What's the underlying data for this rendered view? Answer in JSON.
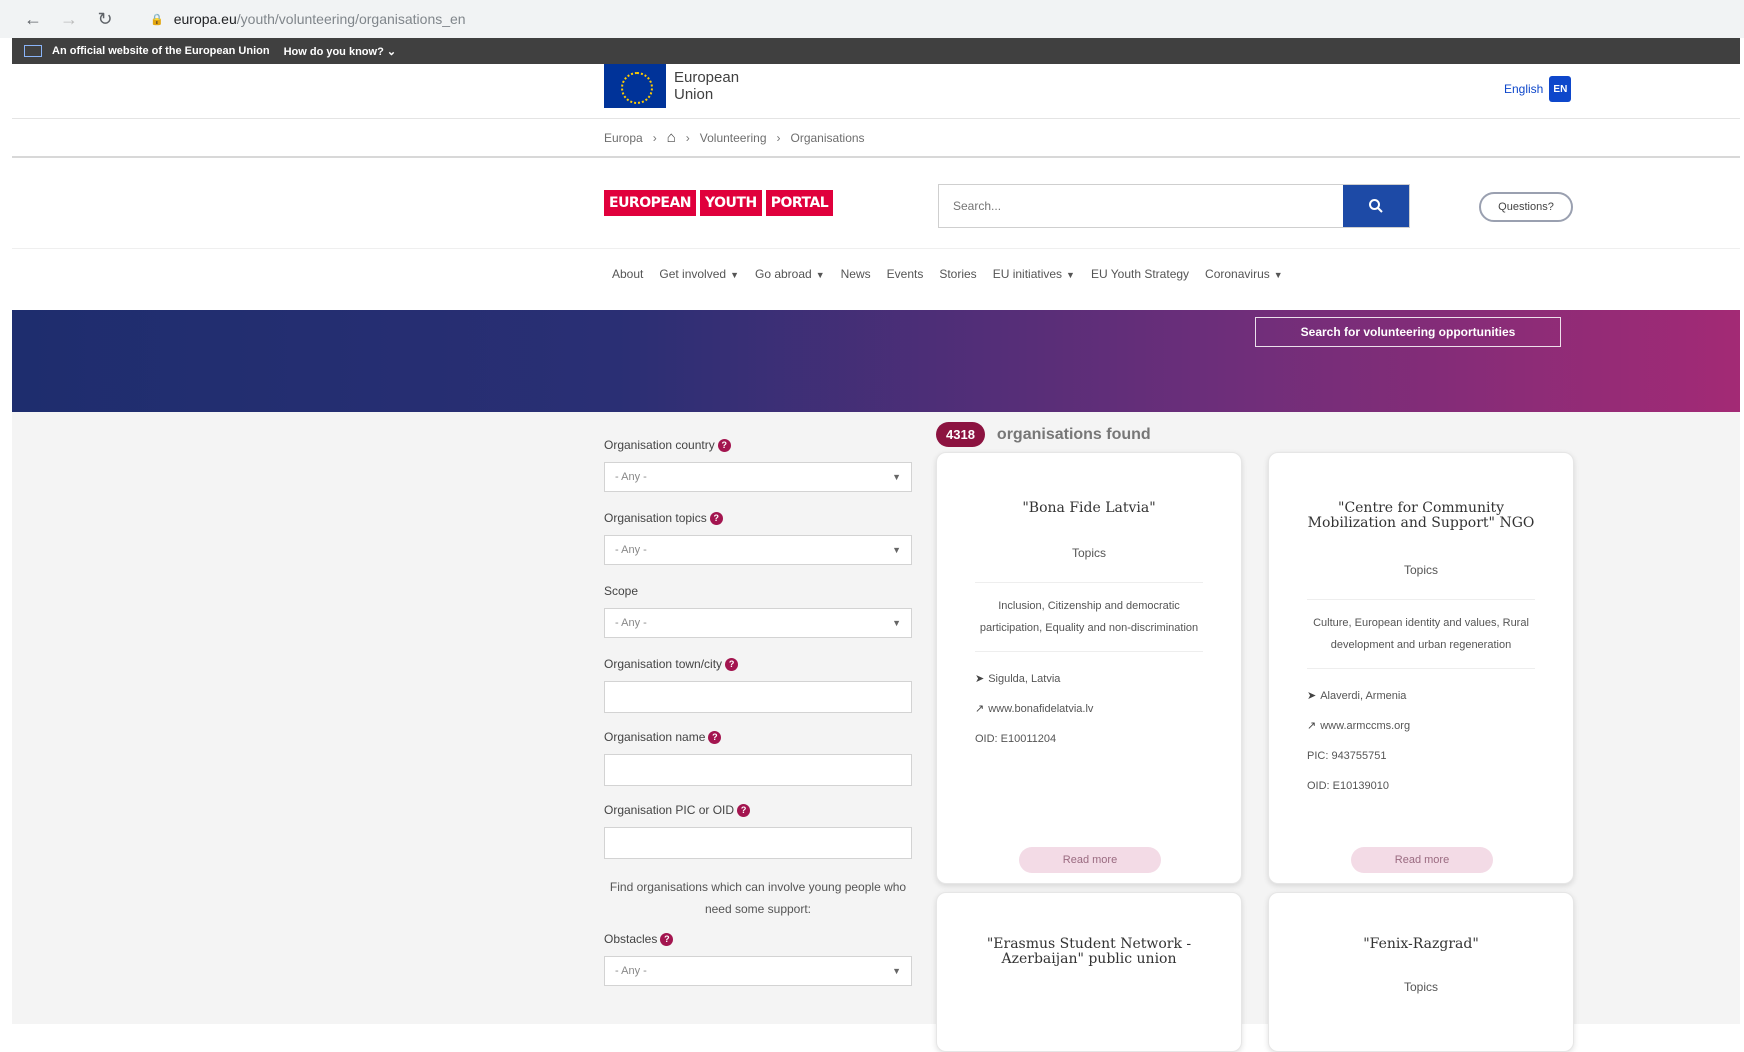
{
  "browser": {
    "url_domain": "europa.eu",
    "url_path": "/youth/volunteering/organisations_en"
  },
  "official_banner": {
    "text": "An official website of the European Union",
    "how": "How do you know?"
  },
  "eu_header": {
    "logo_line1": "European",
    "logo_line2": "Union",
    "language": "English",
    "language_code": "EN"
  },
  "breadcrumb": {
    "items": [
      "Europa",
      "Volunteering",
      "Organisations"
    ]
  },
  "portal": {
    "logo_words": [
      "EUROPEAN",
      "YOUTH",
      "PORTAL"
    ],
    "search_placeholder": "Search...",
    "questions_label": "Questions?"
  },
  "nav": {
    "items": [
      {
        "label": "About",
        "dropdown": false
      },
      {
        "label": "Get involved",
        "dropdown": true
      },
      {
        "label": "Go abroad",
        "dropdown": true
      },
      {
        "label": "News",
        "dropdown": false
      },
      {
        "label": "Events",
        "dropdown": false
      },
      {
        "label": "Stories",
        "dropdown": false
      },
      {
        "label": "EU initiatives",
        "dropdown": true
      },
      {
        "label": "EU Youth Strategy",
        "dropdown": false
      },
      {
        "label": "Coronavirus",
        "dropdown": true
      }
    ]
  },
  "hero": {
    "button_label": "Search for volunteering opportunities"
  },
  "filters": {
    "country_label": "Organisation country",
    "topics_label": "Organisation topics",
    "scope_label": "Scope",
    "town_label": "Organisation town/city",
    "name_label": "Organisation name",
    "pic_label": "Organisation PIC or OID",
    "any_option": "- Any -",
    "note": "Find organisations which can involve young people who need some support:",
    "obstacles_label": "Obstacles",
    "help_icon_glyph": "?"
  },
  "results": {
    "count": "4318",
    "found_text": "organisations found"
  },
  "cards": [
    {
      "title": "\"Bona Fide Latvia\"",
      "topics_label": "Topics",
      "tags": "Inclusion, Citizenship and democratic participation, Equality and non-discrimination",
      "location": "Sigulda, Latvia",
      "website": "www.bonafidelatvia.lv",
      "pic": "",
      "oid": "OID: E10011204",
      "read_more": "Read more"
    },
    {
      "title": "\"Centre for Community Mobilization and Support\" NGO",
      "topics_label": "Topics",
      "tags": "Culture, European identity and values, Rural development and urban regeneration",
      "location": "Alaverdi, Armenia",
      "website": "www.armccms.org",
      "pic": "PIC: 943755751",
      "oid": "OID: E10139010",
      "read_more": "Read more"
    },
    {
      "title": "\"Erasmus Student Network - Azerbaijan\" public union",
      "topics_label": "",
      "tags": "",
      "location": "",
      "website": "",
      "pic": "",
      "oid": "",
      "read_more": ""
    },
    {
      "title": "\"Fenix-Razgrad\"",
      "topics_label": "Topics",
      "tags": "",
      "location": "",
      "website": "",
      "pic": "",
      "oid": "",
      "read_more": ""
    }
  ]
}
